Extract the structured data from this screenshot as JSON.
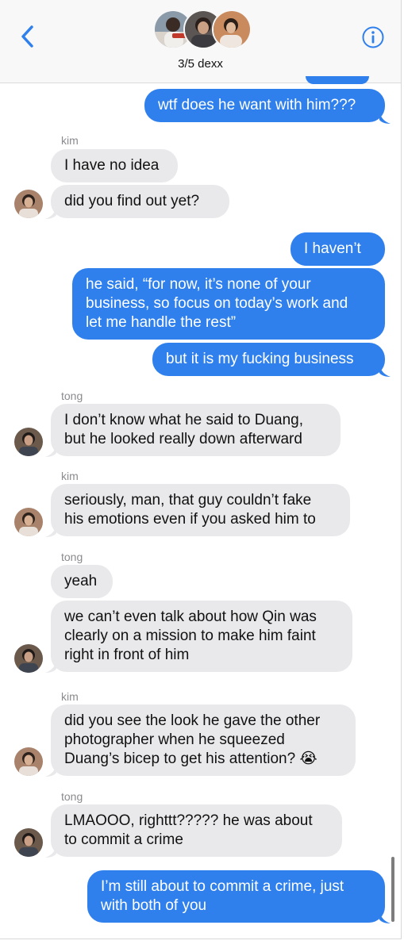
{
  "header": {
    "group_name": "3/5 dexx",
    "back_icon": "chevron-left-icon",
    "info_icon": "info-icon"
  },
  "colors": {
    "outgoing": "#2f80ed",
    "incoming": "#e9e9eb",
    "accent": "#2f80ed"
  },
  "messages": [
    {
      "from": "me",
      "text": "wtf does he want with him???"
    },
    {
      "sender": "kim"
    },
    {
      "from": "kim",
      "text": "I have no idea"
    },
    {
      "from": "kim",
      "text": "did you find out yet?"
    },
    {
      "from": "me",
      "text": "I haven’t"
    },
    {
      "from": "me",
      "lines": [
        "he said, “for now, it’s none of your",
        "business, so focus on today’s work and",
        "let me handle the rest”"
      ]
    },
    {
      "from": "me",
      "text": "but it is my fucking business"
    },
    {
      "sender": "tong"
    },
    {
      "from": "tong",
      "lines": [
        "I don’t know what he said to Duang,",
        "but he looked really down afterward"
      ]
    },
    {
      "sender": "kim"
    },
    {
      "from": "kim",
      "lines": [
        "seriously, man, that guy couldn’t fake",
        "his emotions even if you asked him to"
      ]
    },
    {
      "sender": "tong"
    },
    {
      "from": "tong",
      "text": "yeah"
    },
    {
      "from": "tong",
      "lines": [
        "we can’t even talk about how Qin was",
        "clearly on a mission to make him faint",
        "right in front of him"
      ]
    },
    {
      "sender": "kim"
    },
    {
      "from": "kim",
      "lines": [
        "did you see the look he gave the other",
        "photographer when he squeezed",
        "Duang’s bicep to get his attention? 😭"
      ]
    },
    {
      "sender": "tong"
    },
    {
      "from": "tong",
      "lines": [
        "LMAOOO, righttt????? he was about",
        "to commit a crime"
      ]
    },
    {
      "from": "me",
      "lines": [
        "I’m still about to commit a crime, just",
        "with both of you"
      ]
    }
  ],
  "labels": {
    "kim": "kim",
    "tong": "tong"
  }
}
